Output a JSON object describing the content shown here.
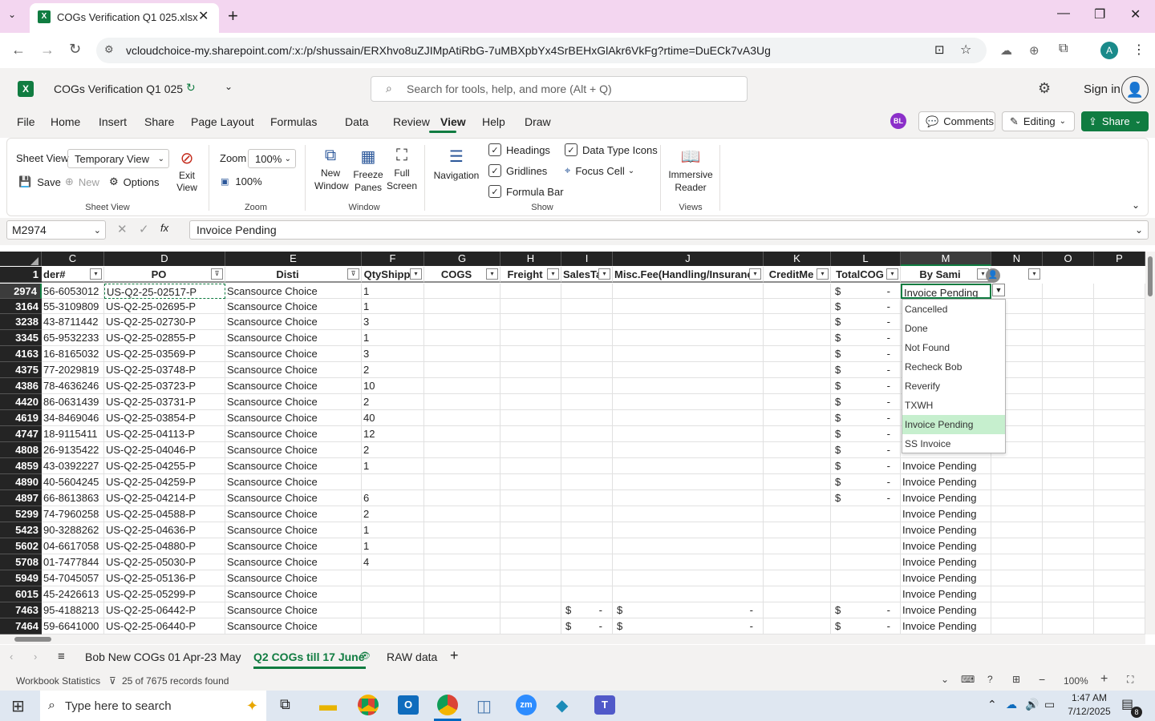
{
  "browser": {
    "tab_title": "COGs Verification Q1 025.xlsx",
    "url": "vcloudchoice-my.sharepoint.com/:x:/p/shussain/ERXhvo8uZJIMpAtiRbG-7uMBXpbYx4SrBEHxGlAkr6VkFg?rtime=DuECk7vA3Ug",
    "avatar": "A"
  },
  "app": {
    "doc_title": "COGs Verification Q1 025",
    "search_placeholder": "Search for tools, help, and more (Alt + Q)",
    "sign_in": "Sign in",
    "menu": [
      "File",
      "Home",
      "Insert",
      "Share",
      "Page Layout",
      "Formulas",
      "Data",
      "Review",
      "View",
      "Help",
      "Draw"
    ],
    "active_menu": "View",
    "user_badge": "BL",
    "comments": "Comments",
    "editing": "Editing",
    "share": "Share"
  },
  "ribbon": {
    "sheet_view_label": "Sheet View",
    "sheet_view_value": "Temporary View",
    "save": "Save",
    "new": "New",
    "options": "Options",
    "exit_view": "Exit View",
    "group_sheet_view": "Sheet View",
    "zoom_label": "Zoom",
    "zoom_value": "100%",
    "zoom_100": "100%",
    "group_zoom": "Zoom",
    "new_window": "New Window",
    "freeze_panes": "Freeze Panes",
    "full_screen": "Full Screen",
    "group_window": "Window",
    "navigation": "Navigation",
    "headings": "Headings",
    "gridlines": "Gridlines",
    "formula_bar": "Formula Bar",
    "data_type_icons": "Data Type Icons",
    "focus_cell": "Focus Cell",
    "group_show": "Show",
    "immersive_reader": "Immersive Reader",
    "group_views": "Views"
  },
  "formula": {
    "name_box": "M2974",
    "content": "Invoice Pending"
  },
  "columns": [
    "C",
    "D",
    "E",
    "F",
    "G",
    "H",
    "I",
    "J",
    "K",
    "L",
    "M",
    "N",
    "O",
    "P"
  ],
  "headers": [
    "der#",
    "PO",
    "Disti",
    "QtyShipp",
    "COGS",
    "Freight",
    "SalesTa",
    "Misc.Fee(Handling/Insuranc",
    "CreditMe",
    "TotalCOG",
    "By Sami"
  ],
  "rows": [
    {
      "n": "2974",
      "c": "56-6053012",
      "d": "US-Q2-25-02517-P",
      "e": "Scansource Choice",
      "f": "1",
      "i": "",
      "j": "",
      "l": true,
      "m": "Invoice Pending"
    },
    {
      "n": "3164",
      "c": "55-3109809",
      "d": "US-Q2-25-02695-P",
      "e": "Scansource Choice",
      "f": "1",
      "i": "",
      "j": "",
      "l": true,
      "m": ""
    },
    {
      "n": "3238",
      "c": "43-8711442",
      "d": "US-Q2-25-02730-P",
      "e": "Scansource Choice",
      "f": "3",
      "i": "",
      "j": "",
      "l": true,
      "m": ""
    },
    {
      "n": "3345",
      "c": "65-9532233",
      "d": "US-Q2-25-02855-P",
      "e": "Scansource Choice",
      "f": "1",
      "i": "",
      "j": "",
      "l": true,
      "m": ""
    },
    {
      "n": "4163",
      "c": "16-8165032",
      "d": "US-Q2-25-03569-P",
      "e": "Scansource Choice",
      "f": "3",
      "i": "",
      "j": "",
      "l": true,
      "m": ""
    },
    {
      "n": "4375",
      "c": "77-2029819",
      "d": "US-Q2-25-03748-P",
      "e": "Scansource Choice",
      "f": "2",
      "i": "",
      "j": "",
      "l": true,
      "m": ""
    },
    {
      "n": "4386",
      "c": "78-4636246",
      "d": "US-Q2-25-03723-P",
      "e": "Scansource Choice",
      "f": "10",
      "i": "",
      "j": "",
      "l": true,
      "m": ""
    },
    {
      "n": "4420",
      "c": "86-0631439",
      "d": "US-Q2-25-03731-P",
      "e": "Scansource Choice",
      "f": "2",
      "i": "",
      "j": "",
      "l": true,
      "m": ""
    },
    {
      "n": "4619",
      "c": "34-8469046",
      "d": "US-Q2-25-03854-P",
      "e": "Scansource Choice",
      "f": "40",
      "i": "",
      "j": "",
      "l": true,
      "m": ""
    },
    {
      "n": "4747",
      "c": "18-9115411",
      "d": "US-Q2-25-04113-P",
      "e": "Scansource Choice",
      "f": "12",
      "i": "",
      "j": "",
      "l": true,
      "m": ""
    },
    {
      "n": "4808",
      "c": "26-9135422",
      "d": "US-Q2-25-04046-P",
      "e": "Scansource Choice",
      "f": "2",
      "i": "",
      "j": "",
      "l": true,
      "m": ""
    },
    {
      "n": "4859",
      "c": "43-0392227",
      "d": "US-Q2-25-04255-P",
      "e": "Scansource Choice",
      "f": "1",
      "i": "",
      "j": "",
      "l": true,
      "m": "Invoice Pending"
    },
    {
      "n": "4890",
      "c": "40-5604245",
      "d": "US-Q2-25-04259-P",
      "e": "Scansource Choice",
      "f": "",
      "i": "",
      "j": "",
      "l": true,
      "m": "Invoice Pending"
    },
    {
      "n": "4897",
      "c": "66-8613863",
      "d": "US-Q2-25-04214-P",
      "e": "Scansource Choice",
      "f": "6",
      "i": "",
      "j": "",
      "l": true,
      "m": "Invoice Pending"
    },
    {
      "n": "5299",
      "c": "74-7960258",
      "d": "US-Q2-25-04588-P",
      "e": "Scansource Choice",
      "f": "2",
      "i": "",
      "j": "",
      "l": false,
      "m": "Invoice Pending"
    },
    {
      "n": "5423",
      "c": "90-3288262",
      "d": "US-Q2-25-04636-P",
      "e": "Scansource Choice",
      "f": "1",
      "i": "",
      "j": "",
      "l": false,
      "m": "Invoice Pending"
    },
    {
      "n": "5602",
      "c": "04-6617058",
      "d": "US-Q2-25-04880-P",
      "e": "Scansource Choice",
      "f": "1",
      "i": "",
      "j": "",
      "l": false,
      "m": "Invoice Pending"
    },
    {
      "n": "5708",
      "c": "01-7477844",
      "d": "US-Q2-25-05030-P",
      "e": "Scansource Choice",
      "f": "4",
      "i": "",
      "j": "",
      "l": false,
      "m": "Invoice Pending"
    },
    {
      "n": "5949",
      "c": "54-7045057",
      "d": "US-Q2-25-05136-P",
      "e": "Scansource Choice",
      "f": "",
      "i": "",
      "j": "",
      "l": false,
      "m": "Invoice Pending"
    },
    {
      "n": "6015",
      "c": "45-2426613",
      "d": "US-Q2-25-05299-P",
      "e": "Scansource Choice",
      "f": "",
      "i": "",
      "j": "",
      "l": false,
      "m": "Invoice Pending"
    },
    {
      "n": "7463",
      "c": "95-4188213",
      "d": "US-Q2-25-06442-P",
      "e": "Scansource Choice",
      "f": "",
      "i": "$",
      "j": "$",
      "l": true,
      "m": "Invoice Pending"
    },
    {
      "n": "7464",
      "c": "59-6641000",
      "d": "US-Q2-25-06440-P",
      "e": "Scansource Choice",
      "f": "",
      "i": "$",
      "j": "$",
      "l": true,
      "m": "Invoice Pending"
    }
  ],
  "currency_symbol": "$",
  "dash": "-",
  "dropdown": {
    "items": [
      "Cancelled",
      "Done",
      "Not Found",
      "Recheck Bob",
      "Reverify",
      "TXWH",
      "Invoice Pending",
      "SS Invoice"
    ],
    "highlighted": "Invoice Pending"
  },
  "sheets": [
    "Bob New COGs 01 Apr-23 May",
    "Q2 COGs till 17 June",
    "RAW data"
  ],
  "active_sheet": "Q2 COGs till 17 June",
  "status": {
    "stats": "Workbook Statistics",
    "filter": "25 of 7675 records found",
    "zoom": "100%"
  },
  "taskbar": {
    "search_placeholder": "Type here to search",
    "time": "1:47 AM",
    "date": "7/12/2025",
    "notif": "8"
  },
  "colors": {
    "excel_green": "#107c41",
    "tab_pink": "#f3d6f0",
    "header_dark": "#242424",
    "dropdown_highlight": "#c6efce"
  }
}
